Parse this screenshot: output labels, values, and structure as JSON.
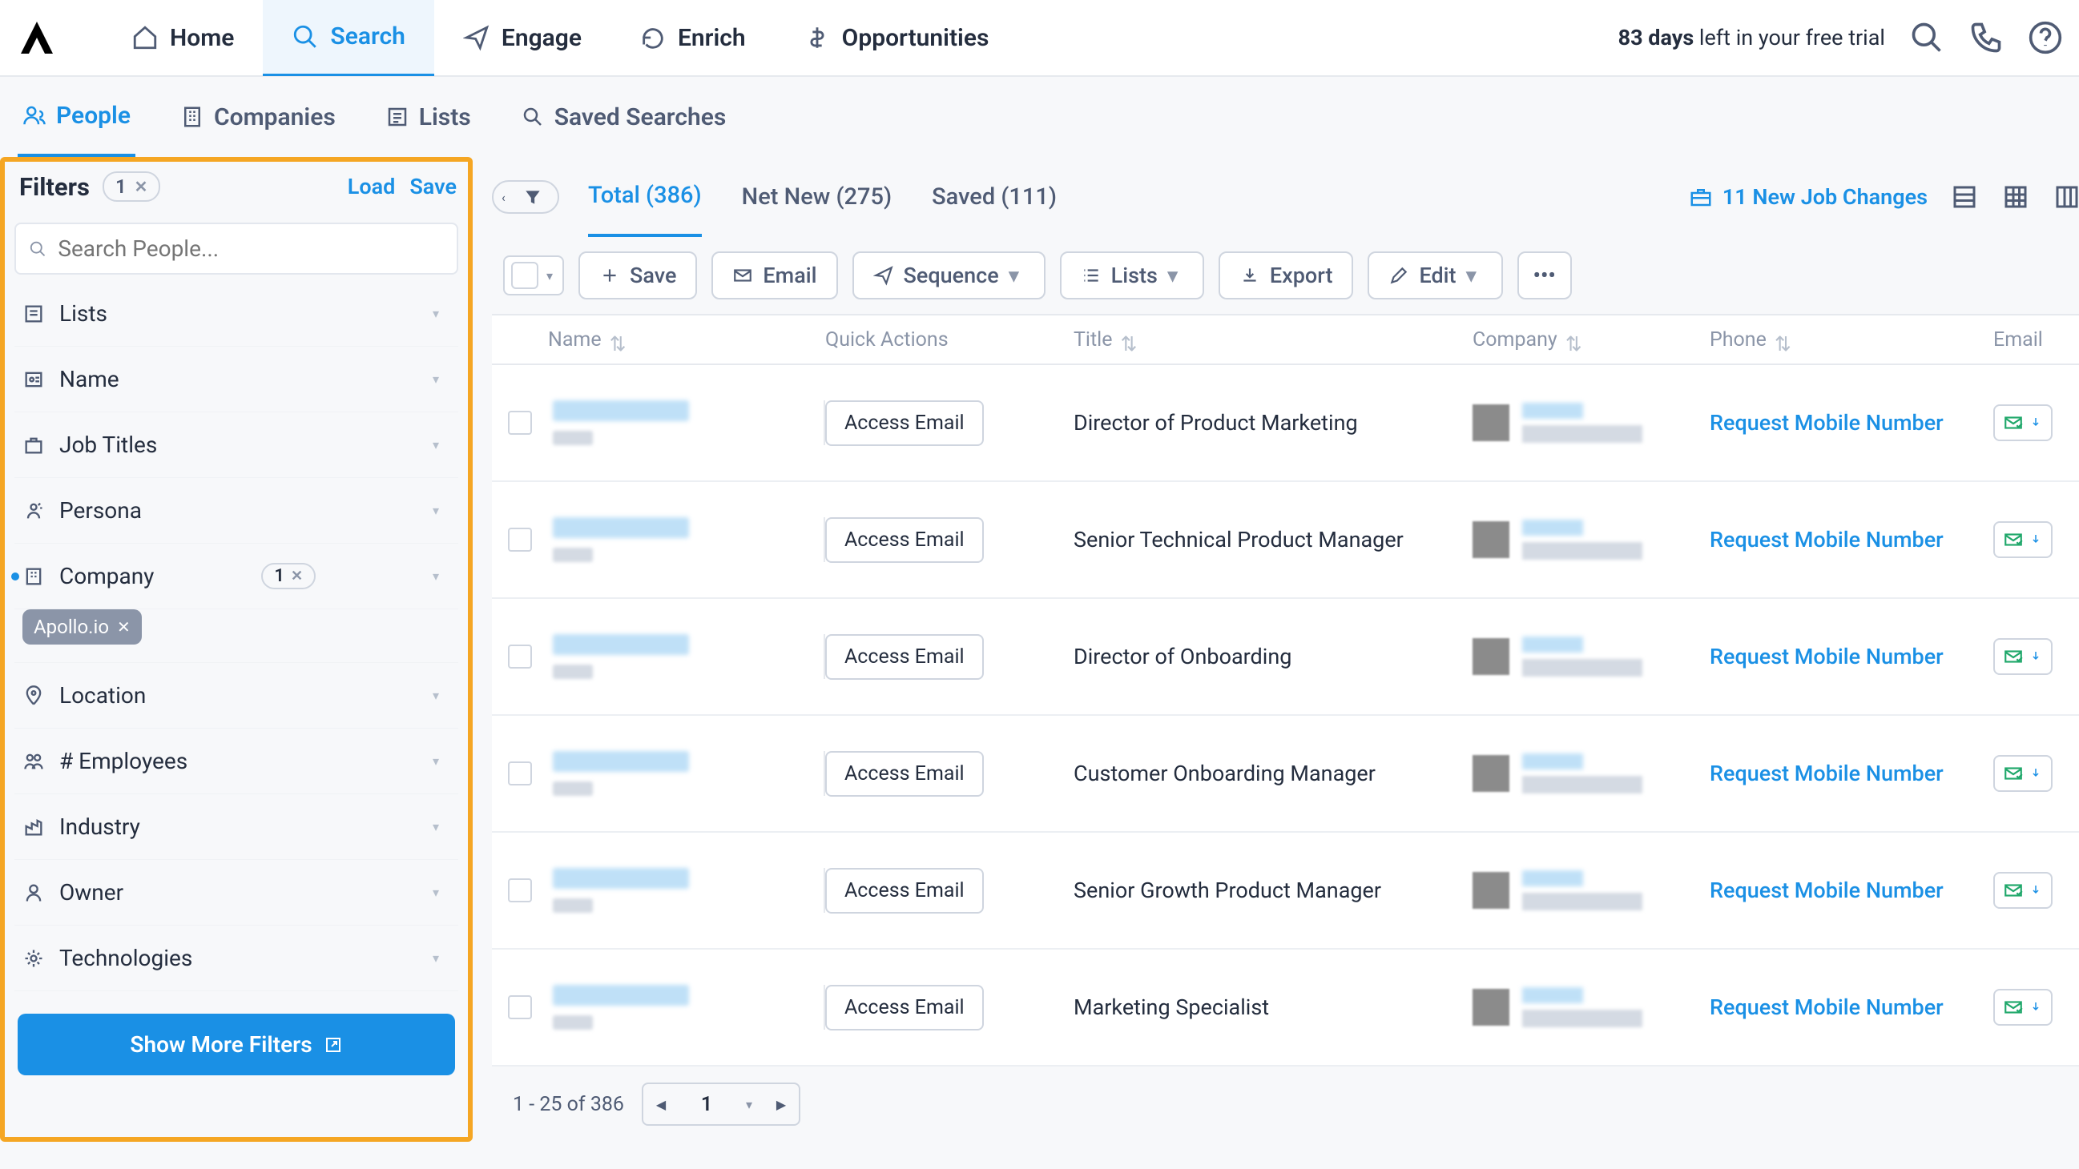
{
  "topbar": {
    "nav": [
      "Home",
      "Search",
      "Engage",
      "Enrich",
      "Opportunities"
    ],
    "trial_days": "83 days",
    "trial_rest": " left in your free trial"
  },
  "subtabs": [
    "People",
    "Companies",
    "Lists",
    "Saved Searches"
  ],
  "filters": {
    "title": "Filters",
    "count": "1",
    "load": "Load",
    "save": "Save",
    "search_placeholder": "Search People...",
    "items": [
      "Lists",
      "Name",
      "Job Titles",
      "Persona",
      "Company",
      "Location",
      "# Employees",
      "Industry",
      "Owner",
      "Technologies"
    ],
    "company_count": "1",
    "company_chip": "Apollo.io",
    "show_more": "Show More Filters"
  },
  "result_tabs": {
    "total": "Total (386)",
    "net_new": "Net New (275)",
    "saved": "Saved (111)"
  },
  "job_changes": "11 New Job Changes",
  "toolbar": {
    "save": "Save",
    "email": "Email",
    "sequence": "Sequence",
    "lists": "Lists",
    "export": "Export",
    "edit": "Edit"
  },
  "columns": {
    "name": "Name",
    "qa": "Quick Actions",
    "title": "Title",
    "company": "Company",
    "phone": "Phone",
    "email": "Email"
  },
  "row_labels": {
    "access_email": "Access Email",
    "request_mobile": "Request Mobile Number"
  },
  "rows": [
    {
      "title": "Director of Product Marketing"
    },
    {
      "title": "Senior Technical Product Manager"
    },
    {
      "title": "Director of Onboarding"
    },
    {
      "title": "Customer Onboarding Manager"
    },
    {
      "title": "Senior Growth Product Manager"
    },
    {
      "title": "Marketing Specialist"
    }
  ],
  "pager": {
    "info": "1 - 25 of 386",
    "page": "1"
  }
}
